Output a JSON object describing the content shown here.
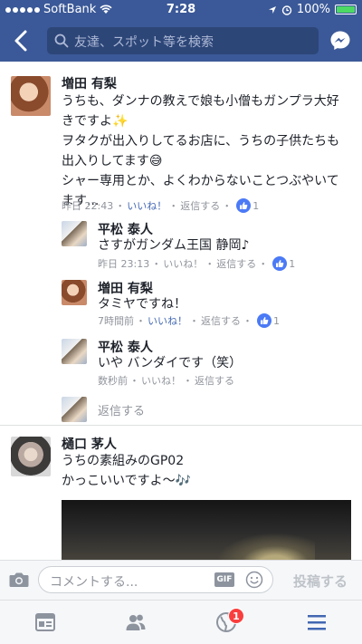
{
  "status_bar": {
    "carrier": "SoftBank",
    "time": "7:28",
    "battery_text": "100%",
    "battery_level": 1.0
  },
  "nav": {
    "search_placeholder": "友達、スポット等を検索",
    "back_icon": "chevron-left-icon",
    "messenger_icon": "messenger-icon"
  },
  "comments": [
    {
      "name": "増田 有梨",
      "lines": [
        "うちも、ダンナの教えで娘も小僧もガンプラ大好",
        "きですよ✨",
        "ヲタクが出入りしてるお店に、うちの子供たちも",
        "出入りしてます😅",
        "シャー専用とか、よくわからないことつぶやいて",
        "ます..."
      ],
      "time": "昨日 22:43",
      "like_label": "いいね！",
      "reply_label": "返信する",
      "like_count": "1",
      "replies": [
        {
          "name": "平松 泰人",
          "text": "さすがガンダム王国 静岡♪",
          "time": "昨日 23:13",
          "like_label": "いいね！",
          "reply_label": "返信する",
          "like_count": "1"
        },
        {
          "name": "増田 有梨",
          "text": "タミヤですね！",
          "time": "7時間前",
          "like_label": "いいね！",
          "reply_label": "返信する",
          "like_count": "1"
        },
        {
          "name": "平松 泰人",
          "text": "いや バンダイです（笑）",
          "time": "数秒前",
          "like_label": "いいね！",
          "reply_label": "返信する",
          "like_count": ""
        }
      ],
      "reply_prompt": "返信する"
    },
    {
      "name": "樋口 茅人",
      "lines": [
        "うちの素組みのGP02",
        "かっこいいですよ〜🎶"
      ]
    }
  ],
  "input_bar": {
    "placeholder": "コメントする...",
    "gif_label": "GIF",
    "post_label": "投稿する"
  },
  "tab_bar": {
    "notifications_badge": "1"
  },
  "colors": {
    "brand": "#3b5998",
    "link": "#4267b2",
    "like": "#4b7af6",
    "badge": "#fa3e3e"
  }
}
